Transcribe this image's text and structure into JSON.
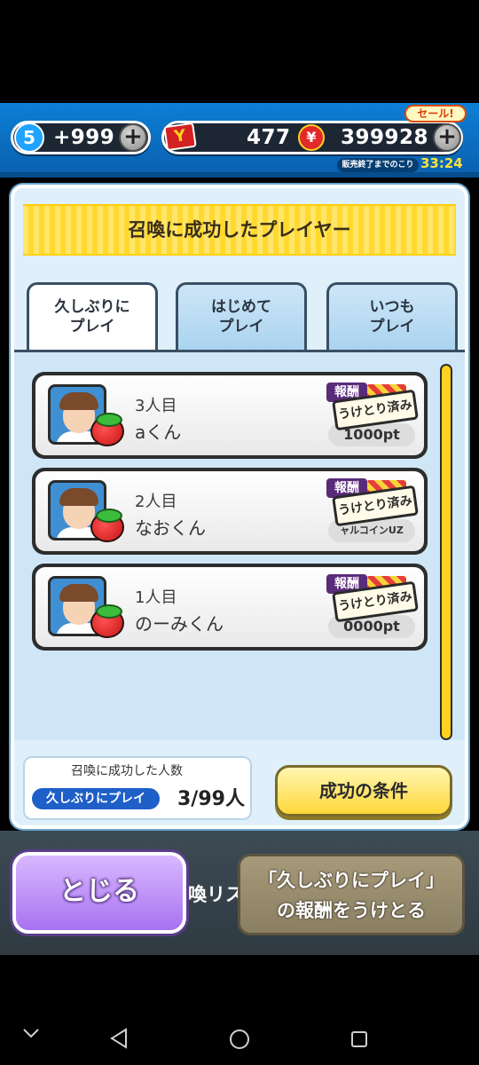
{
  "topbar": {
    "level": "5",
    "stamina": "+999",
    "ticket_count": "477",
    "money": "399928",
    "sale_label": "セール!",
    "sale_timer_label": "販売終了までのこり",
    "sale_timer": "33:24",
    "colors": {
      "bar": "#0d7fd6",
      "pill": "#1d2734"
    }
  },
  "modal": {
    "title": "召喚に成功したプレイヤー",
    "tabs": [
      {
        "label": "久しぶりに\nプレイ",
        "active": true
      },
      {
        "label": "はじめて\nプレイ",
        "active": false
      },
      {
        "label": "いつも\nプレイ",
        "active": false
      }
    ],
    "players": [
      {
        "rank": "3人目",
        "name": "aくん",
        "reward_tag": "報酬",
        "stamp": "うけとり済み",
        "reward": "1000pt"
      },
      {
        "rank": "2人目",
        "name": "なおくん",
        "reward_tag": "報酬",
        "stamp": "うけとり済み",
        "reward": "ャルコインUZ"
      },
      {
        "rank": "1人目",
        "name": "のーみくん",
        "reward_tag": "報酬",
        "stamp": "うけとり済み",
        "reward": "0000pt"
      }
    ],
    "count_box": {
      "label": "召喚に成功した人数",
      "category": "久しぶりにプレイ",
      "value": "3/99人"
    },
    "condition_button": "成功の条件"
  },
  "bottom": {
    "close_button": "とじる",
    "list_button": "喚リス",
    "claim_button_line1": "「久しぶりにプレイ」",
    "claim_button_line2": "の報酬をうけとる"
  },
  "navbar": {
    "icons": [
      "chevron-down-icon",
      "back-icon",
      "home-icon",
      "recents-icon"
    ]
  }
}
